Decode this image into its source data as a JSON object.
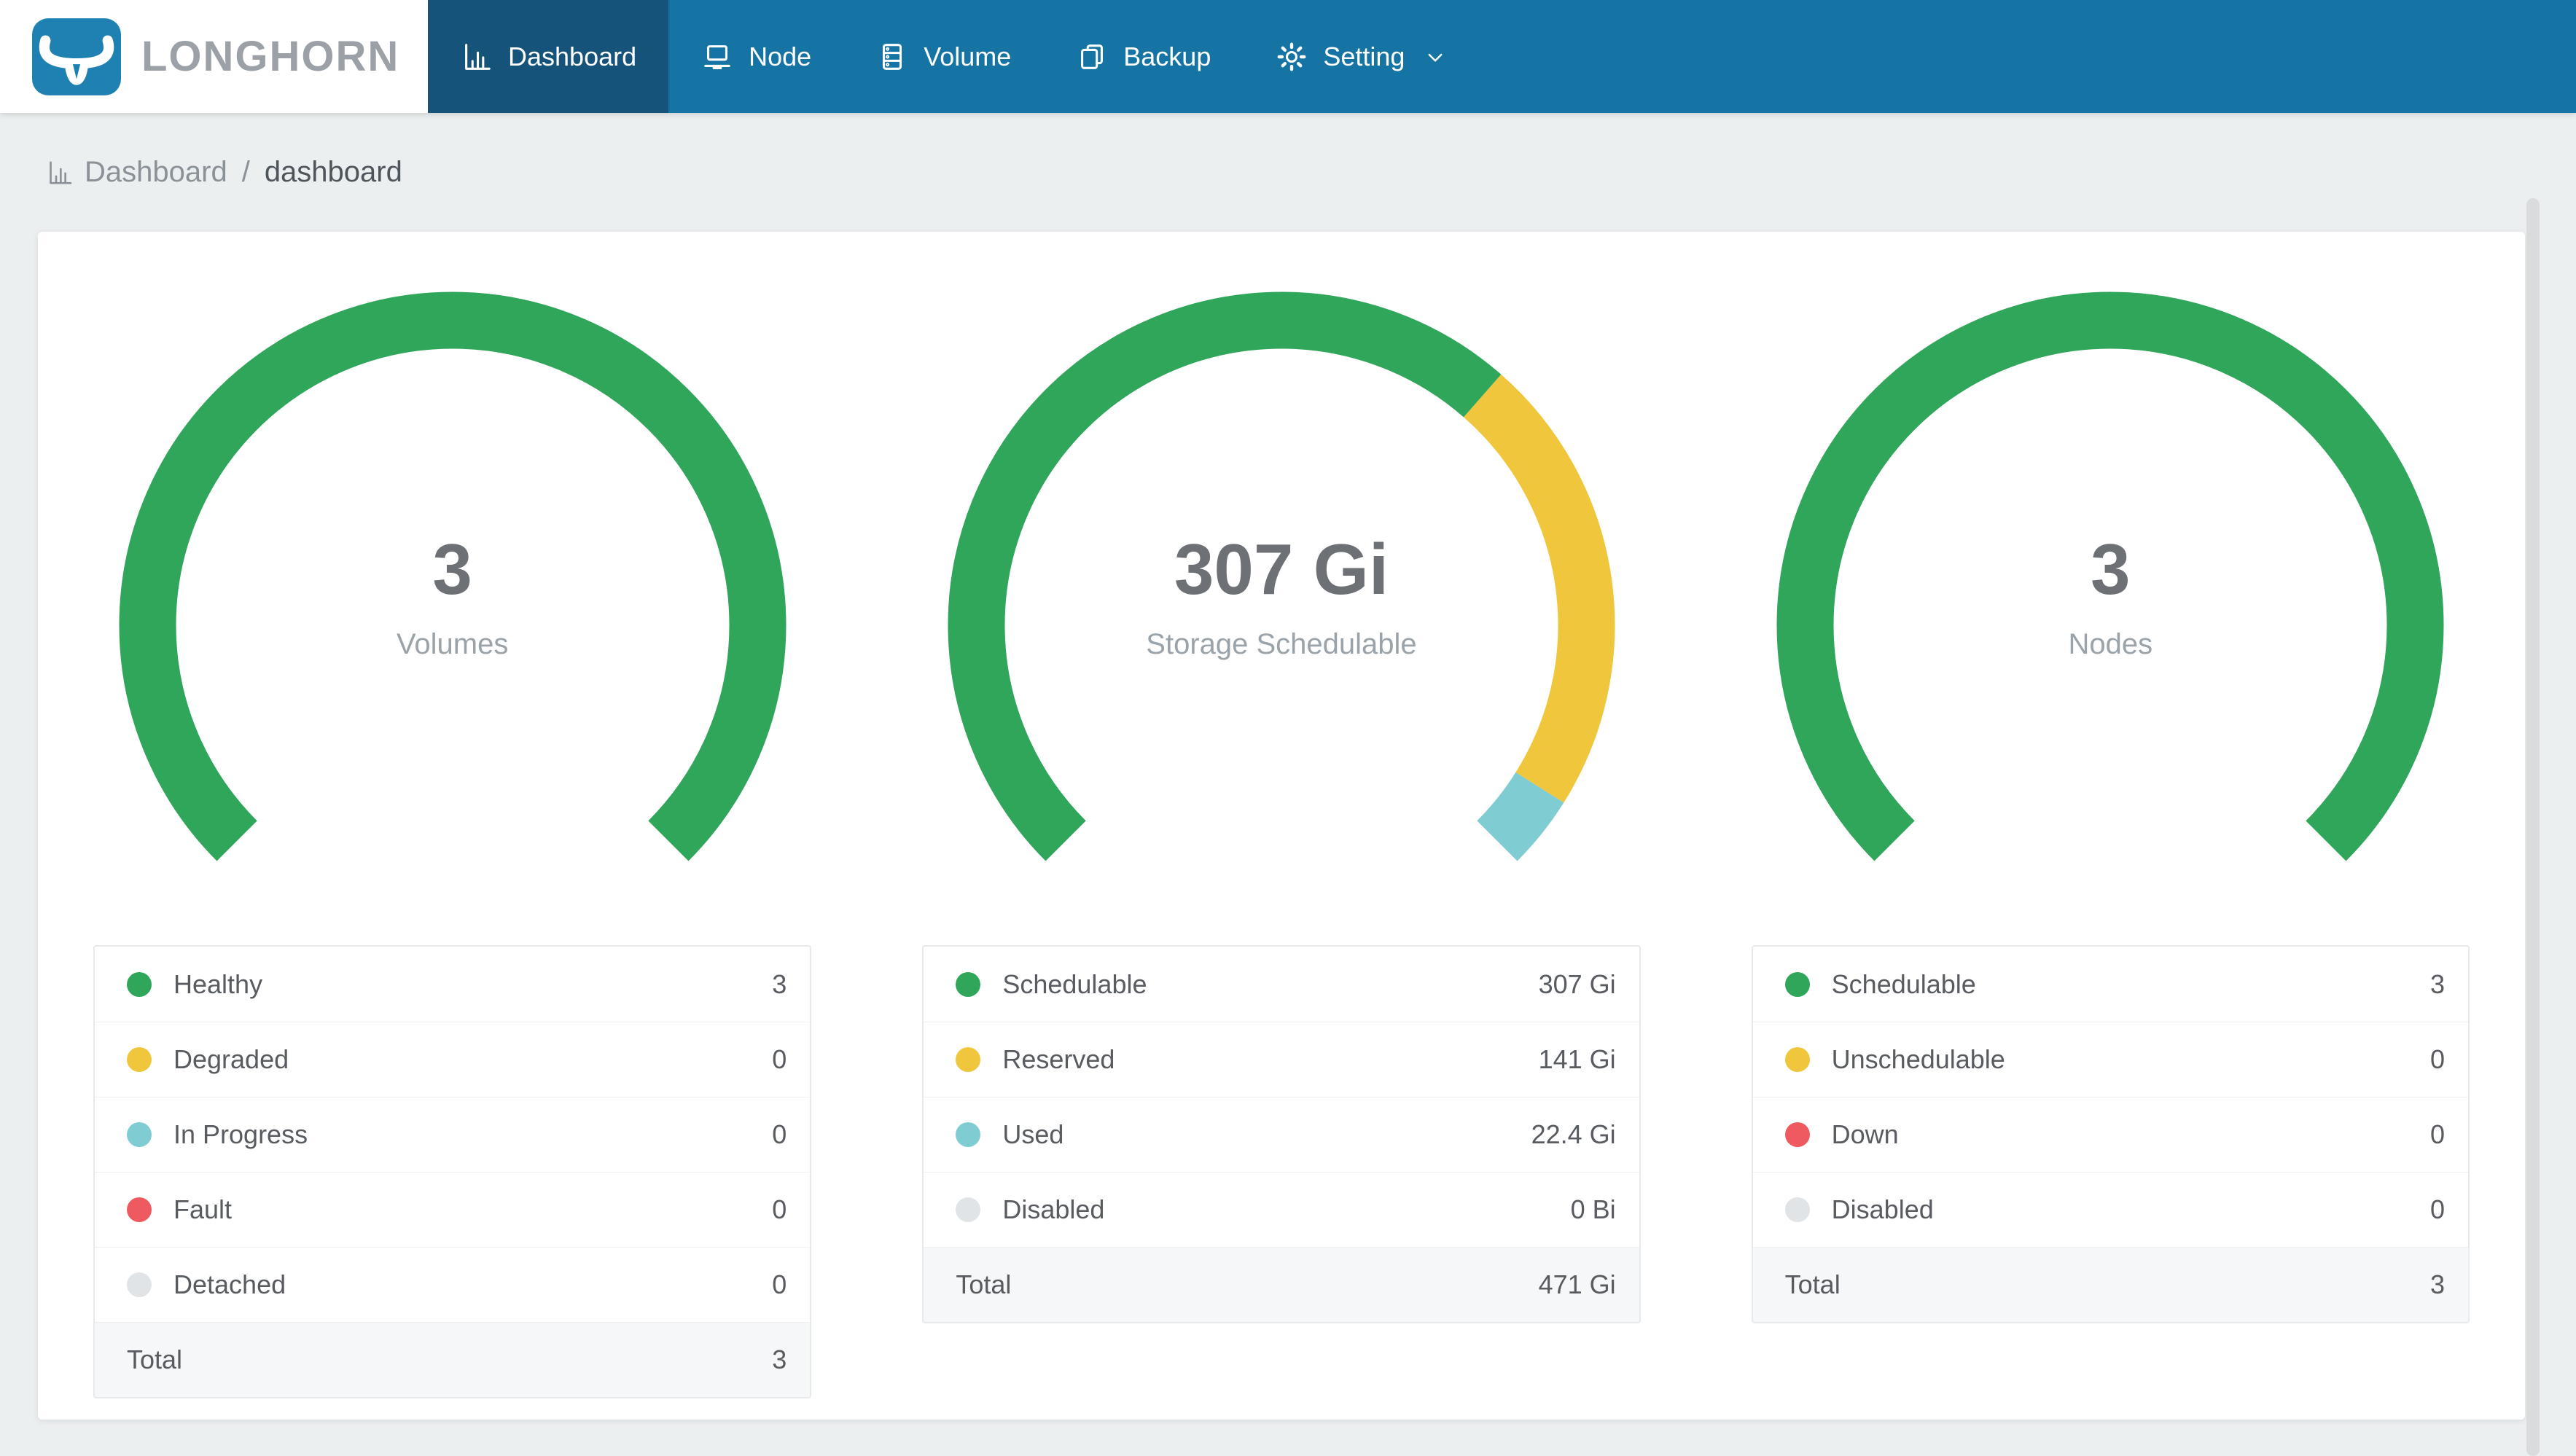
{
  "brand": {
    "name": "LONGHORN"
  },
  "nav": {
    "items": [
      {
        "label": "Dashboard",
        "icon": "dashboard-icon",
        "active": true,
        "has_dropdown": false
      },
      {
        "label": "Node",
        "icon": "node-icon",
        "active": false,
        "has_dropdown": false
      },
      {
        "label": "Volume",
        "icon": "volume-icon",
        "active": false,
        "has_dropdown": false
      },
      {
        "label": "Backup",
        "icon": "backup-icon",
        "active": false,
        "has_dropdown": false
      },
      {
        "label": "Setting",
        "icon": "setting-icon",
        "active": false,
        "has_dropdown": true
      }
    ]
  },
  "breadcrumb": {
    "icon": "chart-icon",
    "section": "Dashboard",
    "separator": "/",
    "page": "dashboard"
  },
  "colors": {
    "navbar_bg": "#1574a4",
    "navbar_active": "#15537b",
    "logo_blue": "#1e81b2",
    "brand_text": "#9ba1a6",
    "page_bg": "#eceff0",
    "crumb_muted": "#8a9298",
    "crumb_current": "#4e555b",
    "gauge_value": "#6d7175",
    "gauge_label": "#9aa3a9",
    "legend_text": "#585c61",
    "table_border": "#e7e9eb",
    "row_divider": "#eef0f2",
    "total_bg": "#f6f7f8",
    "green": "#2fa65a",
    "yellow": "#f0c63d",
    "teal": "#7fccd3",
    "red": "#ee5a5f",
    "gray": "#e1e4e7"
  },
  "chart_data": [
    {
      "type": "donut-gauge",
      "center_value": "3",
      "center_label": "Volumes",
      "arc": {
        "start_deg": 225,
        "span_deg": 270
      },
      "segments": [
        {
          "label": "Healthy",
          "value": 3,
          "color": "#2fa65a"
        },
        {
          "label": "Degraded",
          "value": 0,
          "color": "#f0c63d"
        },
        {
          "label": "In Progress",
          "value": 0,
          "color": "#7fccd3"
        },
        {
          "label": "Fault",
          "value": 0,
          "color": "#ee5a5f"
        },
        {
          "label": "Detached",
          "value": 0,
          "color": "#e1e4e7"
        }
      ],
      "legend": [
        {
          "label": "Healthy",
          "value": "3",
          "color": "#2fa65a"
        },
        {
          "label": "Degraded",
          "value": "0",
          "color": "#f0c63d"
        },
        {
          "label": "In Progress",
          "value": "0",
          "color": "#7fccd3"
        },
        {
          "label": "Fault",
          "value": "0",
          "color": "#ee5a5f"
        },
        {
          "label": "Detached",
          "value": "0",
          "color": "#e1e4e7"
        },
        {
          "label": "Total",
          "value": "3",
          "is_total": true
        }
      ]
    },
    {
      "type": "donut-gauge",
      "center_value": "307 Gi",
      "center_label": "Storage Schedulable",
      "arc": {
        "start_deg": 225,
        "span_deg": 270
      },
      "segments": [
        {
          "label": "Schedulable",
          "value": 307,
          "color": "#2fa65a"
        },
        {
          "label": "Reserved",
          "value": 141,
          "color": "#f0c63d"
        },
        {
          "label": "Used",
          "value": 22.4,
          "color": "#7fccd3"
        },
        {
          "label": "Disabled",
          "value": 0,
          "color": "#e1e4e7"
        }
      ],
      "legend": [
        {
          "label": "Schedulable",
          "value": "307 Gi",
          "color": "#2fa65a"
        },
        {
          "label": "Reserved",
          "value": "141 Gi",
          "color": "#f0c63d"
        },
        {
          "label": "Used",
          "value": "22.4 Gi",
          "color": "#7fccd3"
        },
        {
          "label": "Disabled",
          "value": "0 Bi",
          "color": "#e1e4e7"
        },
        {
          "label": "Total",
          "value": "471 Gi",
          "is_total": true
        }
      ]
    },
    {
      "type": "donut-gauge",
      "center_value": "3",
      "center_label": "Nodes",
      "arc": {
        "start_deg": 225,
        "span_deg": 270
      },
      "segments": [
        {
          "label": "Schedulable",
          "value": 3,
          "color": "#2fa65a"
        },
        {
          "label": "Unschedulable",
          "value": 0,
          "color": "#f0c63d"
        },
        {
          "label": "Down",
          "value": 0,
          "color": "#ee5a5f"
        },
        {
          "label": "Disabled",
          "value": 0,
          "color": "#e1e4e7"
        }
      ],
      "legend": [
        {
          "label": "Schedulable",
          "value": "3",
          "color": "#2fa65a"
        },
        {
          "label": "Unschedulable",
          "value": "0",
          "color": "#f0c63d"
        },
        {
          "label": "Down",
          "value": "0",
          "color": "#ee5a5f"
        },
        {
          "label": "Disabled",
          "value": "0",
          "color": "#e1e4e7"
        },
        {
          "label": "Total",
          "value": "3",
          "is_total": true
        }
      ]
    }
  ]
}
